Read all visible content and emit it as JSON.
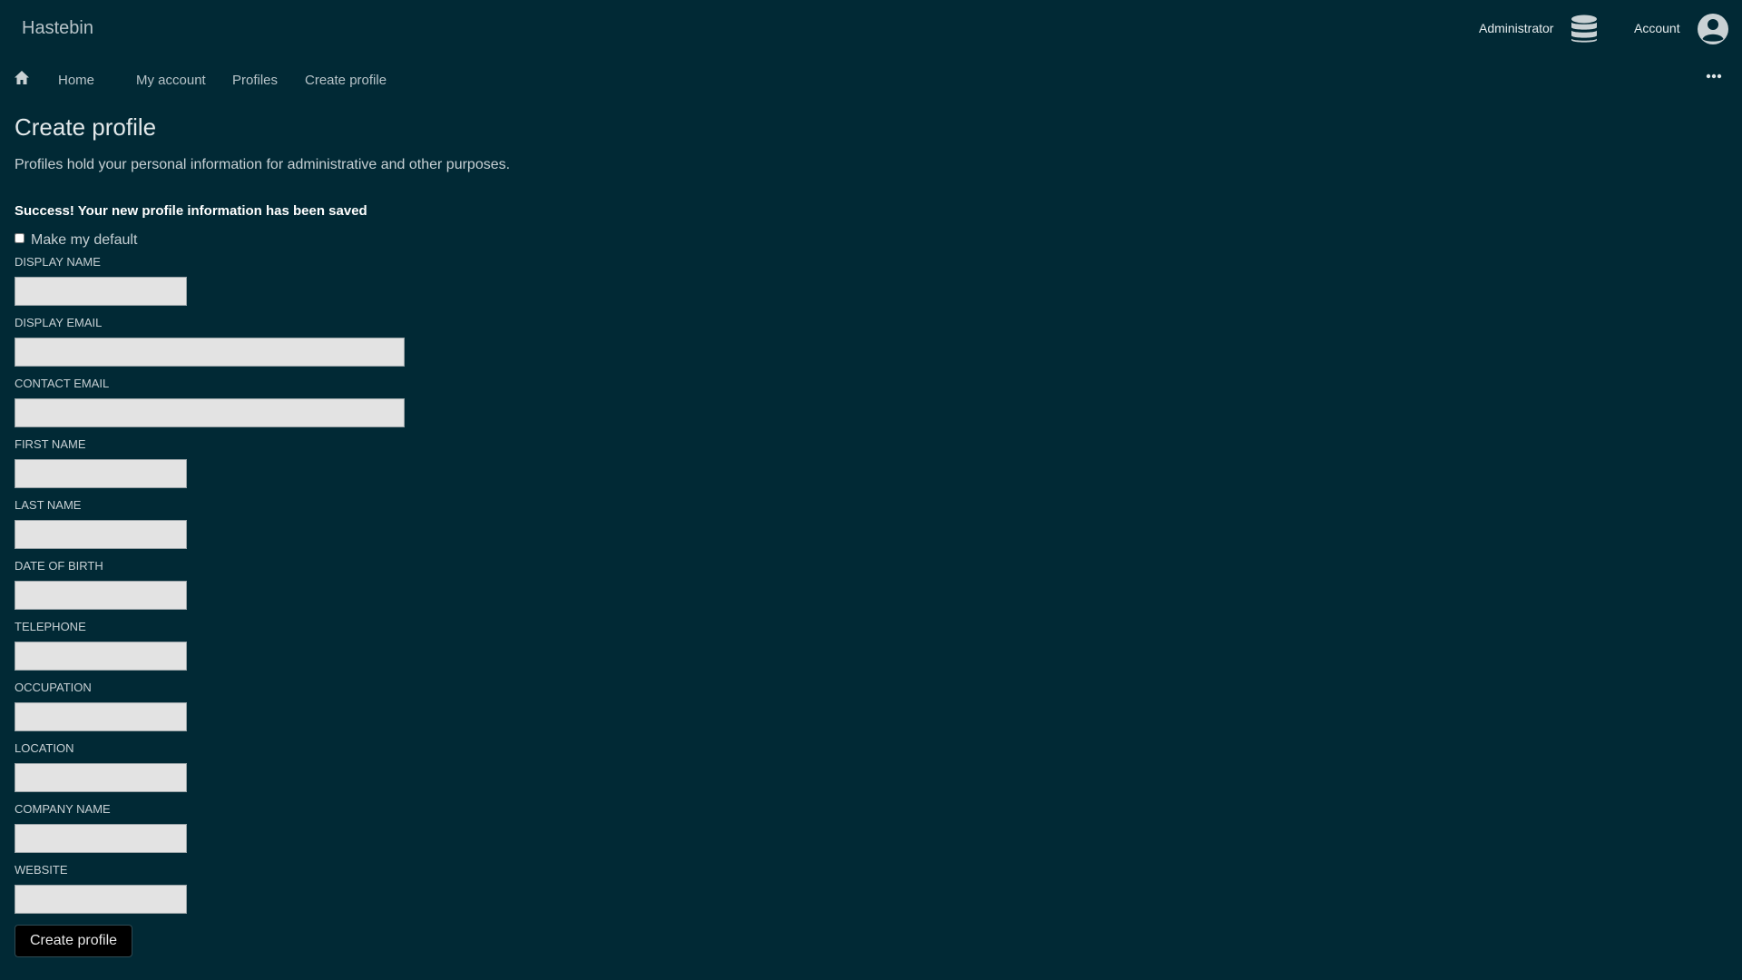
{
  "header": {
    "site_title": "Hastebin",
    "admin_label": "Administrator",
    "account_label": "Account",
    "icons": [
      "database-icon",
      "user-circle-icon"
    ]
  },
  "nav": {
    "home_icon": "home-icon",
    "items": [
      {
        "label": "Home"
      },
      {
        "label": "My account"
      },
      {
        "label": "Profiles"
      },
      {
        "label": "Create profile"
      }
    ],
    "more_icon": "more-icon"
  },
  "main": {
    "title": "Create profile",
    "intro": "Profiles hold your personal information for administrative and other purposes.",
    "success_message": "Success! Your new profile information has been saved",
    "default_checkbox": {
      "label": "Make my default",
      "checked": false
    },
    "fields": [
      {
        "label": "DISPLAY NAME",
        "value": ""
      },
      {
        "label": "DISPLAY EMAIL",
        "value": ""
      },
      {
        "label": "CONTACT EMAIL",
        "value": ""
      },
      {
        "label": "FIRST NAME",
        "value": ""
      },
      {
        "label": "LAST NAME",
        "value": ""
      },
      {
        "label": "DATE OF BIRTH",
        "value": ""
      },
      {
        "label": "TELEPHONE",
        "value": ""
      },
      {
        "label": "OCCUPATION",
        "value": ""
      },
      {
        "label": "LOCATION",
        "value": ""
      },
      {
        "label": "COMPANY NAME",
        "value": ""
      },
      {
        "label": "WEBSITE",
        "value": ""
      }
    ],
    "submit_label": "Create profile"
  },
  "colors": {
    "background": "#012935",
    "input_background": "#e3e3e3",
    "button_background": "#000000"
  }
}
